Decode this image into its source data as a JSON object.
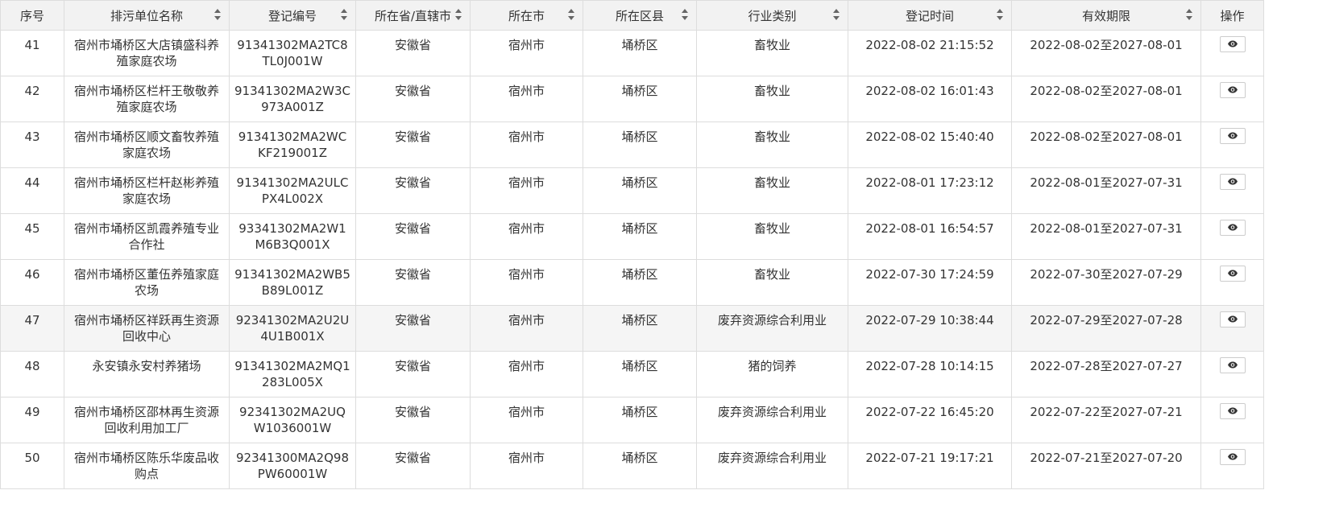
{
  "columns": [
    {
      "label": "序号",
      "sortable": false
    },
    {
      "label": "排污单位名称",
      "sortable": true
    },
    {
      "label": "登记编号",
      "sortable": true
    },
    {
      "label": "所在省/直辖市",
      "sortable": true
    },
    {
      "label": "所在市",
      "sortable": true
    },
    {
      "label": "所在区县",
      "sortable": true
    },
    {
      "label": "行业类别",
      "sortable": true
    },
    {
      "label": "登记时间",
      "sortable": true
    },
    {
      "label": "有效期限",
      "sortable": true
    },
    {
      "label": "操作",
      "sortable": false
    }
  ],
  "rows": [
    {
      "no": "41",
      "name": "宿州市埇桥区大店镇盛科养殖家庭农场",
      "code": "91341302MA2TC8TL0J001W",
      "province": "安徽省",
      "city": "宿州市",
      "district": "埇桥区",
      "industry": "畜牧业",
      "reg_time": "2022-08-02 21:15:52",
      "validity": "2022-08-02至2027-08-01"
    },
    {
      "no": "42",
      "name": "宿州市埇桥区栏杆王敬敬养殖家庭农场",
      "code": "91341302MA2W3C973A001Z",
      "province": "安徽省",
      "city": "宿州市",
      "district": "埇桥区",
      "industry": "畜牧业",
      "reg_time": "2022-08-02 16:01:43",
      "validity": "2022-08-02至2027-08-01"
    },
    {
      "no": "43",
      "name": "宿州市埇桥区顺文畜牧养殖家庭农场",
      "code": "91341302MA2WCKF219001Z",
      "province": "安徽省",
      "city": "宿州市",
      "district": "埇桥区",
      "industry": "畜牧业",
      "reg_time": "2022-08-02 15:40:40",
      "validity": "2022-08-02至2027-08-01"
    },
    {
      "no": "44",
      "name": "宿州市埇桥区栏杆赵彬养殖家庭农场",
      "code": "91341302MA2ULCPX4L002X",
      "province": "安徽省",
      "city": "宿州市",
      "district": "埇桥区",
      "industry": "畜牧业",
      "reg_time": "2022-08-01 17:23:12",
      "validity": "2022-08-01至2027-07-31"
    },
    {
      "no": "45",
      "name": "宿州市埇桥区凯霞养殖专业合作社",
      "code": "93341302MA2W1M6B3Q001X",
      "province": "安徽省",
      "city": "宿州市",
      "district": "埇桥区",
      "industry": "畜牧业",
      "reg_time": "2022-08-01 16:54:57",
      "validity": "2022-08-01至2027-07-31"
    },
    {
      "no": "46",
      "name": "宿州市埇桥区董伍养殖家庭农场",
      "code": "91341302MA2WB5B89L001Z",
      "province": "安徽省",
      "city": "宿州市",
      "district": "埇桥区",
      "industry": "畜牧业",
      "reg_time": "2022-07-30 17:24:59",
      "validity": "2022-07-30至2027-07-29"
    },
    {
      "no": "47",
      "name": "宿州市埇桥区祥跃再生资源回收中心",
      "code": "92341302MA2U2U4U1B001X",
      "province": "安徽省",
      "city": "宿州市",
      "district": "埇桥区",
      "industry": "废弃资源综合利用业",
      "reg_time": "2022-07-29 10:38:44",
      "validity": "2022-07-29至2027-07-28",
      "highlight": true
    },
    {
      "no": "48",
      "name": "永安镇永安村养猪场",
      "code": "91341302MA2MQ1283L005X",
      "province": "安徽省",
      "city": "宿州市",
      "district": "埇桥区",
      "industry": "猪的饲养",
      "reg_time": "2022-07-28 10:14:15",
      "validity": "2022-07-28至2027-07-27"
    },
    {
      "no": "49",
      "name": "宿州市埇桥区邵林再生资源回收利用加工厂",
      "code": "92341302MA2UQW1036001W",
      "province": "安徽省",
      "city": "宿州市",
      "district": "埇桥区",
      "industry": "废弃资源综合利用业",
      "reg_time": "2022-07-22 16:45:20",
      "validity": "2022-07-22至2027-07-21"
    },
    {
      "no": "50",
      "name": "宿州市埇桥区陈乐华废品收购点",
      "code": "92341300MA2Q98PW60001W",
      "province": "安徽省",
      "city": "宿州市",
      "district": "埇桥区",
      "industry": "废弃资源综合利用业",
      "reg_time": "2022-07-21 19:17:21",
      "validity": "2022-07-21至2027-07-20"
    }
  ],
  "icons": {
    "view": "eye-icon"
  }
}
